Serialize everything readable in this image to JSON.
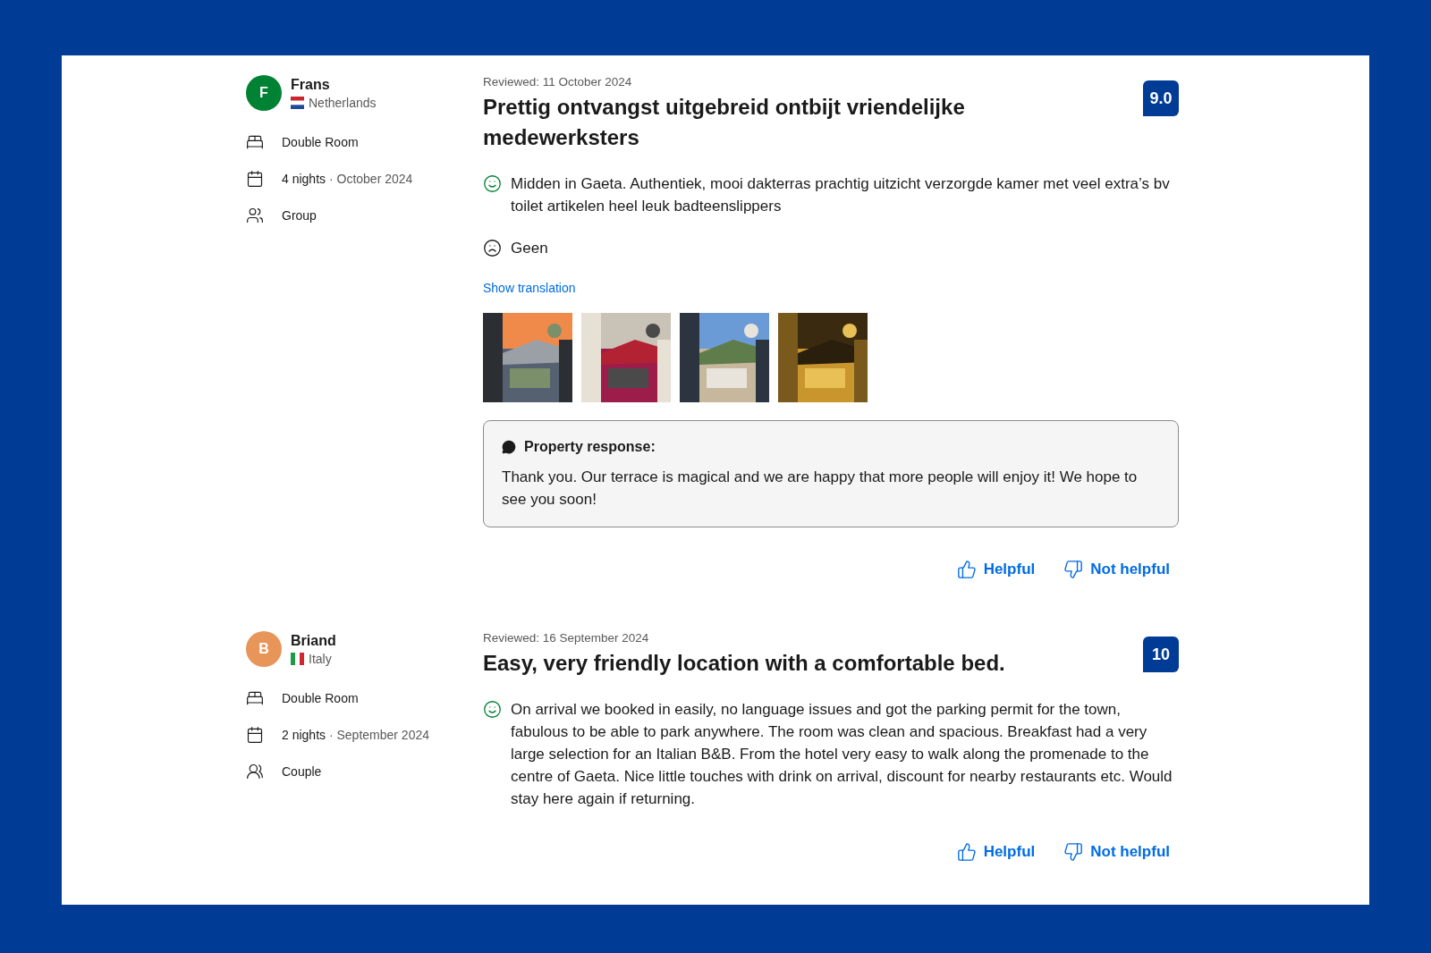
{
  "reviews": [
    {
      "reviewer": {
        "initial": "F",
        "name": "Frans",
        "country": "Netherlands",
        "flag": {
          "kind": "netherlands"
        },
        "color": "#008234"
      },
      "stay": [
        {
          "kind": "room",
          "text": "Double Room"
        },
        {
          "kind": "dates",
          "nights": "4 nights",
          "period": "· October 2024"
        },
        {
          "kind": "group",
          "text": "Group"
        }
      ],
      "reviewed": "Reviewed: 11 October 2024",
      "title": "Prettig ontvangst uitgebreid ontbijt vriendelijke medewerksters",
      "score": "9.0",
      "comments": [
        {
          "kind": "positive",
          "text": "Midden in Gaeta. Authentiek, mooi dakterras prachtig uitzicht verzorgde kamer met veel extra’s bv toilet artikelen heel leuk badteenslippers"
        },
        {
          "kind": "negative",
          "text": "Geen"
        }
      ],
      "translation_link": "Show translation",
      "photos": [
        {
          "kind": "picture"
        },
        {
          "kind": "picture"
        },
        {
          "kind": "picture"
        },
        {
          "kind": "picture"
        }
      ],
      "property_response": {
        "heading": "Property response:",
        "text": "Thank you. Our terrace is magical and we are happy that more people will enjoy it! We hope to see you soon!"
      },
      "actions": [
        "Helpful",
        "Not helpful"
      ]
    },
    {
      "reviewer": {
        "initial": "B",
        "name": "Briand",
        "country": "Italy",
        "flag": {
          "kind": "italy"
        },
        "color": "#e8955a"
      },
      "stay": [
        {
          "kind": "room",
          "text": "Double Room"
        },
        {
          "kind": "dates",
          "nights": "2 nights",
          "period": "· September 2024"
        },
        {
          "kind": "couple",
          "text": "Couple"
        }
      ],
      "reviewed": "Reviewed: 16 September 2024",
      "title": "Easy, very friendly location with a comfortable bed.",
      "score": "10",
      "comments": [
        {
          "kind": "positive",
          "text": "On arrival we booked in easily, no language issues and got the parking permit for the town, fabulous to be able to park anywhere. The room was clean and spacious. Breakfast had a very large selection for an Italian B&B. From the hotel very easy to walk along the promenade to the centre of Gaeta. Nice little touches with drink on arrival, discount for nearby restaurants etc. Would stay here again if returning."
        }
      ],
      "actions": [
        "Helpful",
        "Not helpful"
      ]
    }
  ]
}
